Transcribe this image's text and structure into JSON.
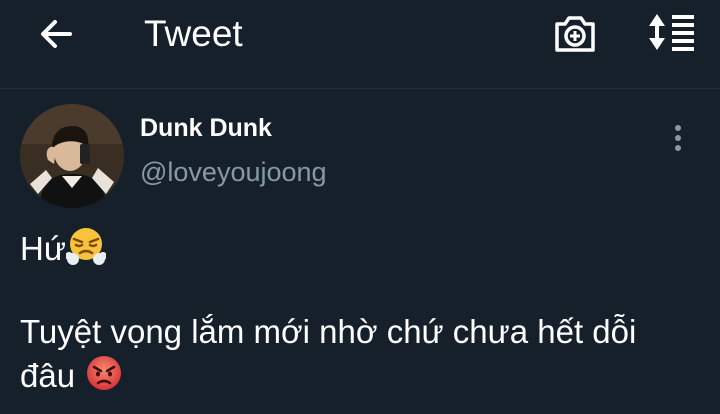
{
  "header": {
    "title": "Tweet",
    "back_icon": "back-arrow-icon",
    "camera_icon": "camera-add-icon",
    "sort_icon": "sort-toggle-icon"
  },
  "tweet": {
    "author_name": "Dunk Dunk",
    "author_handle": "@loveyoujoong",
    "line1": "Hứ",
    "line2": "Tuyệt vọng lắm mới nhờ chứ chưa hết dỗi",
    "line3": "đâu ",
    "emoji1": "face-with-steam-from-nose",
    "emoji2": "angry-face"
  },
  "colors": {
    "background": "#15202b",
    "text_primary": "#ffffff",
    "text_secondary": "#8899a6"
  }
}
